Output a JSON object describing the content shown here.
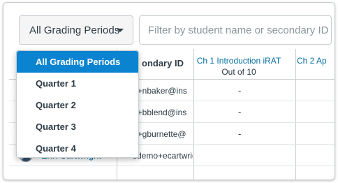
{
  "toolbar": {
    "period_selected": "All Grading Periods",
    "search_placeholder": "Filter by student name or secondary ID"
  },
  "dropdown": {
    "items": [
      {
        "label": "All Grading Periods",
        "active": true
      },
      {
        "label": "Quarter 1",
        "active": false
      },
      {
        "label": "Quarter 2",
        "active": false
      },
      {
        "label": "Quarter 3",
        "active": false
      },
      {
        "label": "Quarter 4",
        "active": false
      }
    ]
  },
  "grid": {
    "secondary_header": "ondary ID",
    "columns": [
      {
        "title": "Ch 1 Introduction iRAT",
        "sub": "Out of 10"
      },
      {
        "title": "Ch 2 Ap",
        "sub": ""
      }
    ],
    "rows": [
      {
        "secondary": "o+nbaker@ins",
        "score": "-"
      },
      {
        "secondary": "o+bblend@ins",
        "score": "-"
      },
      {
        "secondary": "o+gburnette@",
        "score": "-"
      },
      {
        "name": "Erin Cartwright",
        "secondary": "sdemo+ecartwright",
        "score": ""
      }
    ]
  },
  "colors": {
    "accent": "#0a84d1",
    "link": "#0770a3",
    "text": "#2d3b45",
    "border": "#c7cdd1"
  }
}
